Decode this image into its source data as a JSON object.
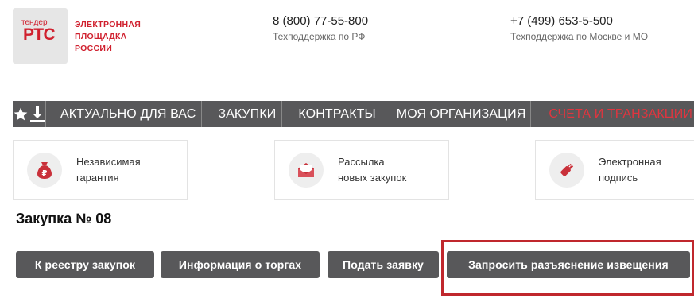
{
  "header": {
    "logo": {
      "small": "тендер",
      "big": "РТС",
      "lines": [
        "ЭЛЕКТРОННАЯ",
        "ПЛОЩАДКА",
        "РОССИИ"
      ]
    },
    "contacts": [
      {
        "phone": "8 (800) 77-55-800",
        "label": "Техподдержка по РФ"
      },
      {
        "phone": "+7 (499) 653-5-500",
        "label": "Техподдержка по Москве и МО"
      }
    ]
  },
  "nav": {
    "icons": [
      "star-icon",
      "download-icon"
    ],
    "items": [
      "АКТУАЛЬНО ДЛЯ ВАС",
      "ЗАКУПКИ",
      "КОНТРАКТЫ",
      "МОЯ ОРГАНИЗАЦИЯ",
      "СЧЕТА И ТРАНЗАКЦИИ"
    ],
    "accent_color": "#e0353f",
    "bar_color": "#58585a"
  },
  "promos": [
    {
      "icon": "money-bag-icon",
      "lines": [
        "Независимая",
        "гарантия"
      ]
    },
    {
      "icon": "envelope-icon",
      "lines": [
        "Рассылка",
        "новых закупок"
      ]
    },
    {
      "icon": "usb-key-icon",
      "lines": [
        "Электронная",
        "подпись"
      ]
    }
  ],
  "main": {
    "title": "Закупка № 08",
    "buttons": [
      "К реестру закупок",
      "Информация о торгах",
      "Подать заявку",
      "Запросить разъяснение извещения"
    ]
  },
  "colors": {
    "brand": "#d0202e",
    "highlight": "#c0272d"
  }
}
